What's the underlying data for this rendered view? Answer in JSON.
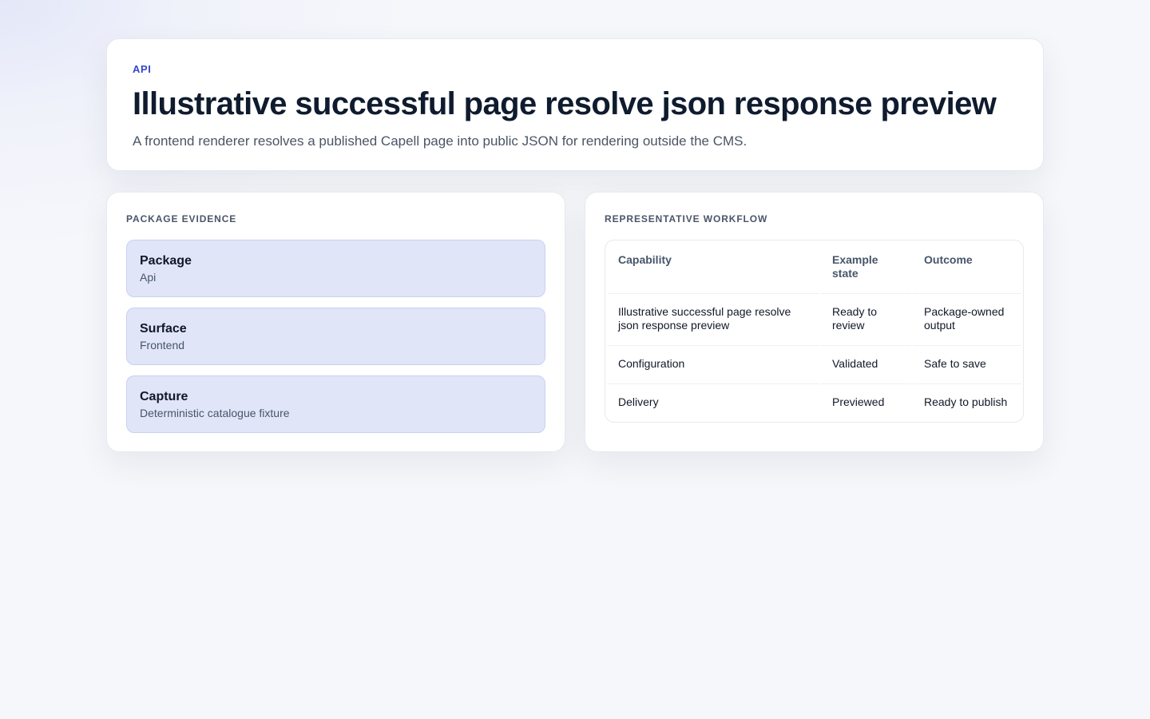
{
  "hero": {
    "eyebrow": "API",
    "title": "Illustrative successful page resolve json response preview",
    "description": "A frontend renderer resolves a published Capell page into public JSON for rendering outside the CMS."
  },
  "evidence": {
    "title": "PACKAGE EVIDENCE",
    "items": [
      {
        "label": "Package",
        "value": "Api"
      },
      {
        "label": "Surface",
        "value": "Frontend"
      },
      {
        "label": "Capture",
        "value": "Deterministic catalogue fixture"
      }
    ]
  },
  "workflow": {
    "title": "REPRESENTATIVE WORKFLOW",
    "columns": [
      "Capability",
      "Example state",
      "Outcome"
    ],
    "rows": [
      [
        "Illustrative successful page resolve json response preview",
        "Ready to review",
        "Package-owned output"
      ],
      [
        "Configuration",
        "Validated",
        "Safe to save"
      ],
      [
        "Delivery",
        "Previewed",
        "Ready to publish"
      ]
    ]
  }
}
